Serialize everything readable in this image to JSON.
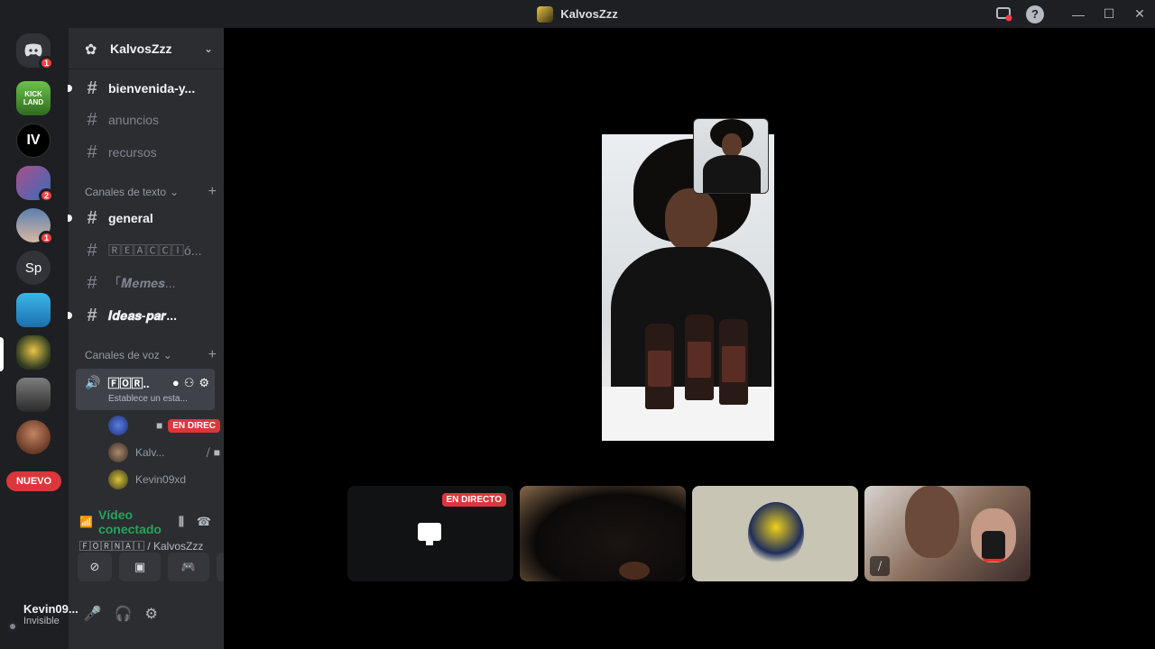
{
  "window": {
    "title": "KalvosZzz"
  },
  "server_rail": {
    "servers": [
      {
        "name": "discord-home",
        "badge": "1"
      },
      {
        "name": "kick-land",
        "label": "KICK LAND"
      },
      {
        "name": "iv-studios",
        "label": "IV"
      },
      {
        "name": "server-4",
        "badge": "2"
      },
      {
        "name": "server-5",
        "badge": "1"
      },
      {
        "name": "sp",
        "label": "Sp"
      },
      {
        "name": "server-7"
      },
      {
        "name": "kalvoszzz"
      },
      {
        "name": "server-9"
      },
      {
        "name": "server-10"
      }
    ],
    "new_label": "NUEVO"
  },
  "guild": {
    "name": "KalvosZzz"
  },
  "channels": {
    "top": [
      {
        "name": "bienvenida-y...",
        "unread": true
      },
      {
        "name": "anuncios",
        "unread": false
      },
      {
        "name": "recursos",
        "unread": false
      }
    ],
    "text_category": "Canales de texto",
    "text": [
      {
        "name": "general",
        "unread": true
      },
      {
        "name": "🅁🄴🄰🄲🄲🄸ó...",
        "unread": false
      },
      {
        "name": "「𝑴𝒆𝒎𝒆𝒔...",
        "unread": false
      },
      {
        "name": "𝑰𝒅𝒆𝒂𝒔-𝒑𝒂𝒓...",
        "unread": true
      }
    ],
    "voice_category": "Canales de voz",
    "voice_channel": {
      "name": "🄵🄾🅁...",
      "status": "Establece un esta..."
    },
    "voice_users": [
      {
        "name": "",
        "live": "EN DIREC"
      },
      {
        "name": "Kalv..."
      },
      {
        "name": "Kevin09xd"
      }
    ]
  },
  "rtc": {
    "status": "Vídeo conectado",
    "location": "🄵🄾🅁🄽🄰🄸 / KalvosZzz"
  },
  "user": {
    "name": "Kevin09...",
    "status": "Invisible"
  },
  "stage": {
    "live_label": "EN DIRECTO"
  }
}
